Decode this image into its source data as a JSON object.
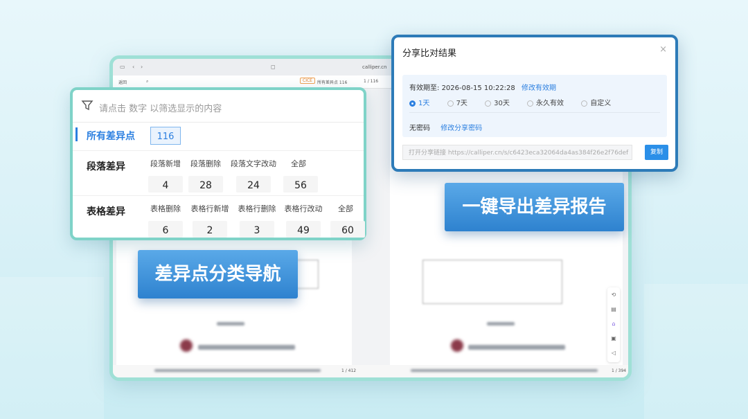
{
  "browser": {
    "url": "calliper.cn",
    "toolbar_back": "返回",
    "toolbar_tag": "CICE",
    "toolbar_diff": "所有差异点 116",
    "toolbar_page": "1 / 116",
    "left_page": "1 / 412",
    "right_page": "1 / 394"
  },
  "filter": {
    "placeholder": "请点击 数字 以筛选显示的内容",
    "all_label": "所有差异点",
    "all_count": "116",
    "para": {
      "label": "段落差异",
      "items": [
        {
          "h": "段落新增",
          "v": "4"
        },
        {
          "h": "段落删除",
          "v": "28"
        },
        {
          "h": "段落文字改动",
          "v": "24"
        },
        {
          "h": "全部",
          "v": "56"
        }
      ]
    },
    "table": {
      "label": "表格差异",
      "items": [
        {
          "h": "表格删除",
          "v": "6"
        },
        {
          "h": "表格行新增",
          "v": "2"
        },
        {
          "h": "表格行删除",
          "v": "3"
        },
        {
          "h": "表格行改动",
          "v": "49"
        },
        {
          "h": "全部",
          "v": "60"
        }
      ]
    }
  },
  "share": {
    "title": "分享比对结果",
    "close": "×",
    "expiry_label": "有效期至:",
    "expiry_value": "2026-08-15 10:22:28",
    "modify_expiry": "修改有效期",
    "options": [
      "1天",
      "7天",
      "30天",
      "永久有效",
      "自定义"
    ],
    "selected_option": "1天",
    "password_label": "无密码",
    "modify_password": "修改分享密码",
    "link": "打开分享链接 https://calliper.cn/s/c6423eca32064da4as384f26e2f76def",
    "copy": "复制"
  },
  "banners": {
    "nav": "差异点分类导航",
    "export": "一键导出差异报告"
  },
  "colors": {
    "accent": "#2b7fe0",
    "filter_border": "#7fd3c8",
    "share_border": "#2d7bb8"
  }
}
